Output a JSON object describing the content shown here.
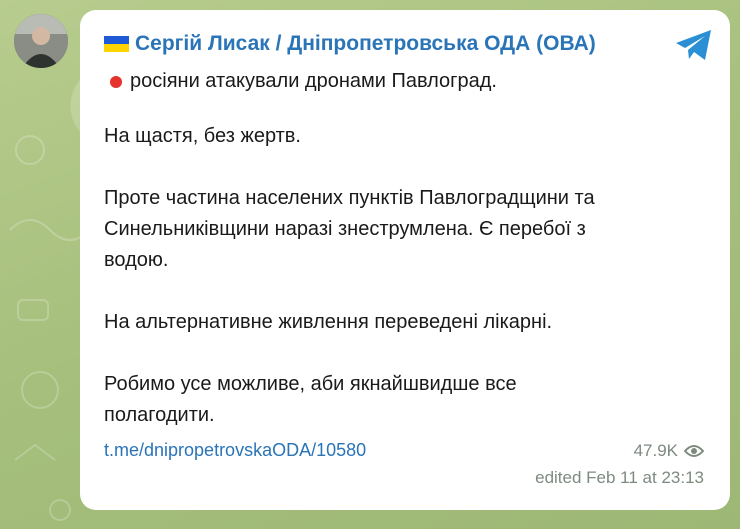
{
  "channel": {
    "name": "Сергій Лисак / Дніпропетровська ОДА (ОВА)",
    "flag_colors": [
      "#1f5bd7",
      "#ffd400"
    ]
  },
  "post": {
    "first_line": "росіяни атакували дронами Павлоград.",
    "paragraphs": [
      "На щастя, без жертв.",
      "Проте частина населених пунктів Павлоградщини та\nСинельниківщини наразі знеструмлена. Є перебої з\nводою.",
      "На альтернативне живлення переведені лікарні.",
      "Робимо усе можливе, аби якнайшвидше все\nполагодити."
    ],
    "link": "t.me/dnipropetrovskaODA/10580",
    "views": "47.9K",
    "edited": "edited  Feb 11 at 23:13"
  },
  "icons": {
    "share": "telegram-share-icon",
    "views": "eye-icon",
    "bullet": "red-circle-icon"
  },
  "colors": {
    "accent": "#2a74b8",
    "meta": "#7e8a80",
    "background": "#a9c27f",
    "bullet": "#e5322d"
  }
}
